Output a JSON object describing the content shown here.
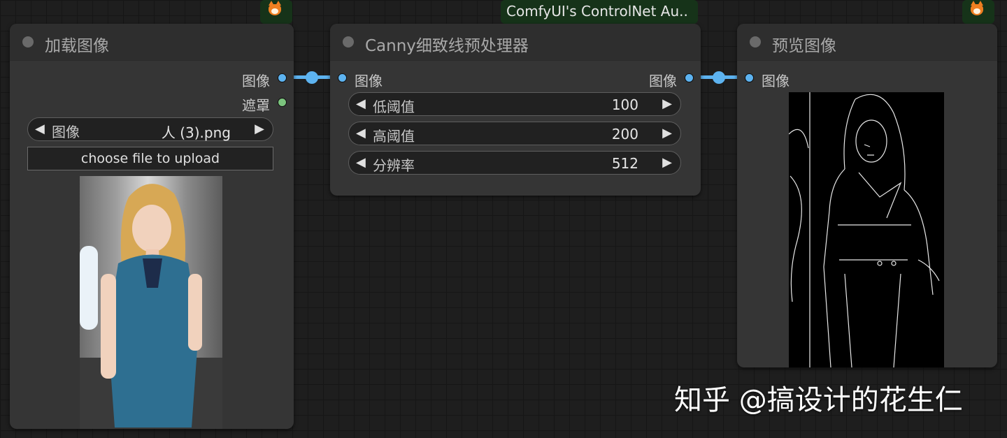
{
  "nodes": {
    "load_image": {
      "title": "加载图像",
      "out_image_label": "图像",
      "out_mask_label": "遮罩",
      "image_widget": {
        "label": "图像",
        "value": "人 (3).png"
      },
      "upload_button_label": "choose file to upload"
    },
    "canny": {
      "badge_label": "ComfyUI's ControlNet Au..",
      "title": "Canny细致线预处理器",
      "in_image_label": "图像",
      "out_image_label": "图像",
      "widgets": [
        {
          "label": "低阈值",
          "value": "100"
        },
        {
          "label": "高阈值",
          "value": "200"
        },
        {
          "label": "分辨率",
          "value": "512"
        }
      ]
    },
    "preview": {
      "title": "预览图像",
      "in_image_label": "图像"
    }
  },
  "watermark": "知乎 @搞设计的花生仁",
  "icons": {
    "badge": "fox-icon",
    "arrow_left": "◀",
    "arrow_right": "▶"
  },
  "colors": {
    "link": "#5db3f0",
    "image_slot": "#5db3f0",
    "mask_slot": "#7cc47e",
    "badge_bg": "#163319"
  }
}
